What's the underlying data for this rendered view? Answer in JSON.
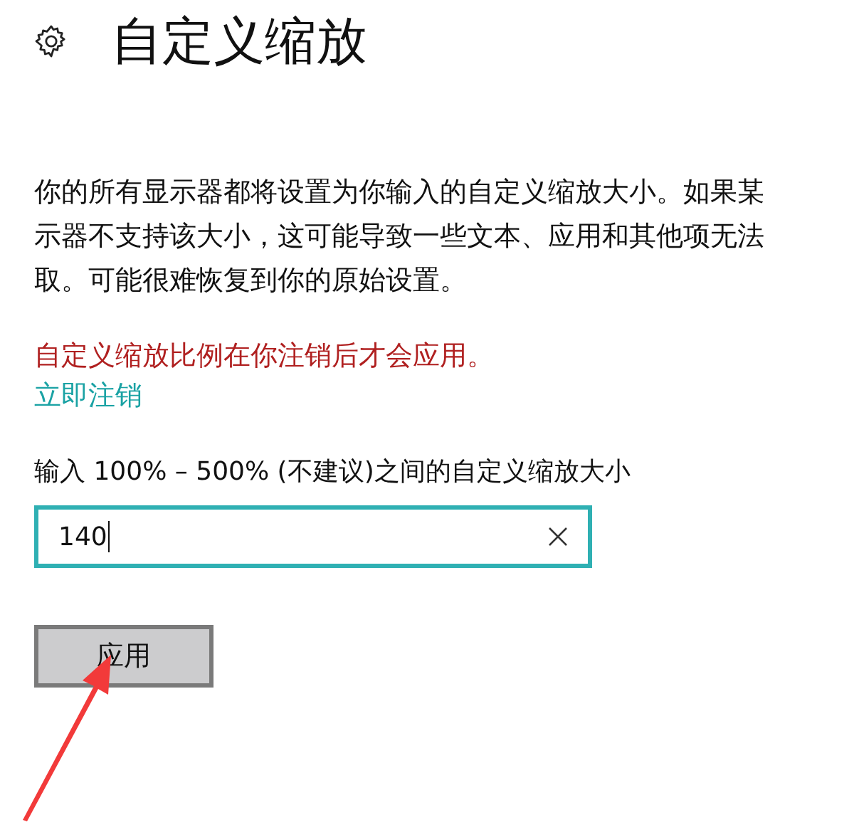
{
  "header": {
    "title": "自定义缩放"
  },
  "description_lines": [
    "你的所有显示器都将设置为你输入的自定义缩放大小。如果某",
    "示器不支持该大小，这可能导致一些文本、应用和其他项无法",
    "取。可能很难恢复到你的原始设置。"
  ],
  "warning": "自定义缩放比例在你注销后才会应用。",
  "sign_out_link": "立即注销",
  "scale_field": {
    "label": "输入 100% – 500% (不建议)之间的自定义缩放大小",
    "value": "140",
    "focused": true
  },
  "apply_button": "应用"
}
